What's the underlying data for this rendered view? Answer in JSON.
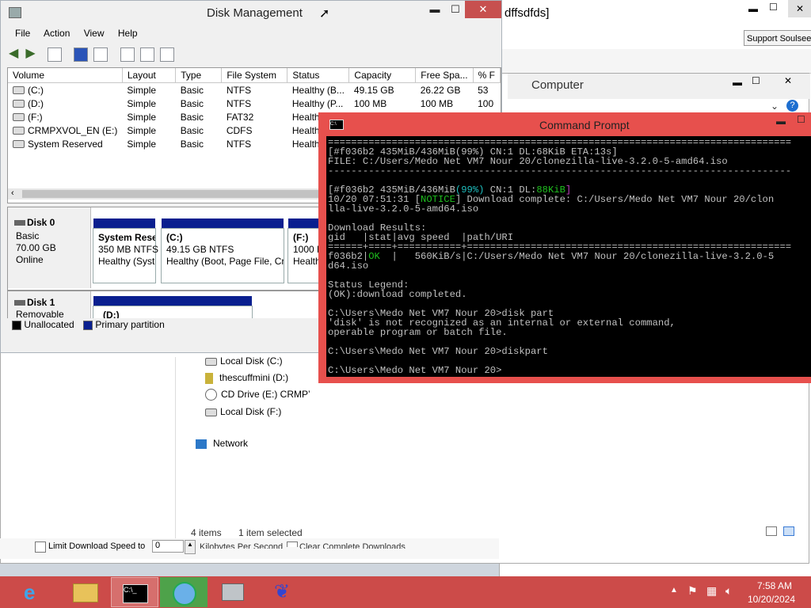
{
  "background_window": {
    "title_fragment": "dffsdfds]",
    "toolbar_button": "Support Soulseek"
  },
  "disk_management": {
    "title": "Disk Management",
    "menu": [
      "File",
      "Action",
      "View",
      "Help"
    ],
    "columns": [
      "Volume",
      "Layout",
      "Type",
      "File System",
      "Status",
      "Capacity",
      "Free Spa...",
      "% F"
    ],
    "rows": [
      {
        "volume": "(C:)",
        "layout": "Simple",
        "type": "Basic",
        "fs": "NTFS",
        "status": "Healthy (B...",
        "capacity": "49.15 GB",
        "free": "26.22 GB",
        "pct": "53"
      },
      {
        "volume": "(D:)",
        "layout": "Simple",
        "type": "Basic",
        "fs": "NTFS",
        "status": "Healthy (P...",
        "capacity": "100 MB",
        "free": "100 MB",
        "pct": "100"
      },
      {
        "volume": "(F:)",
        "layout": "Simple",
        "type": "Basic",
        "fs": "FAT32",
        "status": "Health",
        "capacity": "",
        "free": "",
        "pct": ""
      },
      {
        "volume": "CRMPXVOL_EN (E:)",
        "layout": "Simple",
        "type": "Basic",
        "fs": "CDFS",
        "status": "Health",
        "capacity": "",
        "free": "",
        "pct": ""
      },
      {
        "volume": "System Reserved",
        "layout": "Simple",
        "type": "Basic",
        "fs": "NTFS",
        "status": "Health",
        "capacity": "",
        "free": "",
        "pct": ""
      }
    ],
    "disk0": {
      "name": "Disk 0",
      "type": "Basic",
      "size": "70.00 GB",
      "state": "Online"
    },
    "disk0_parts": [
      {
        "name": "System Rese",
        "size": "350 MB NTFS",
        "status": "Healthy (Syst"
      },
      {
        "name": "(C:)",
        "size": "49.15 GB NTFS",
        "status": "Healthy (Boot, Page File, Cr"
      },
      {
        "name": "(F:)",
        "size": "1000 M",
        "status": "Health"
      }
    ],
    "disk1": {
      "name": "Disk 1",
      "type": "Removable"
    },
    "disk1_part": "(D:)",
    "legend": {
      "unallocated": "Unallocated",
      "primary": "Primary partition",
      "unallocated_color": "#000000",
      "primary_color": "#0a1f8f"
    }
  },
  "computer_window": {
    "title": "Computer",
    "items": [
      "Local Disk (C:)",
      "thescuffmini (D:)",
      "CD Drive (E:) CRMP’",
      "Local Disk (F:)"
    ],
    "network": "Network",
    "status_items": "4 items",
    "status_selected": "1 item selected"
  },
  "soulseek_footer": {
    "limit_label": "Limit Download Speed to",
    "limit_value": "0",
    "unit_label": "Kilobytes Per Second",
    "clear_label": "Clear Complete Downloads"
  },
  "command_prompt": {
    "title": "Command Prompt",
    "accent": "#e7504d"
  },
  "taskbar": {
    "time": "7:58 AM",
    "date": "10/20/2024",
    "color": "#cc4b49"
  }
}
